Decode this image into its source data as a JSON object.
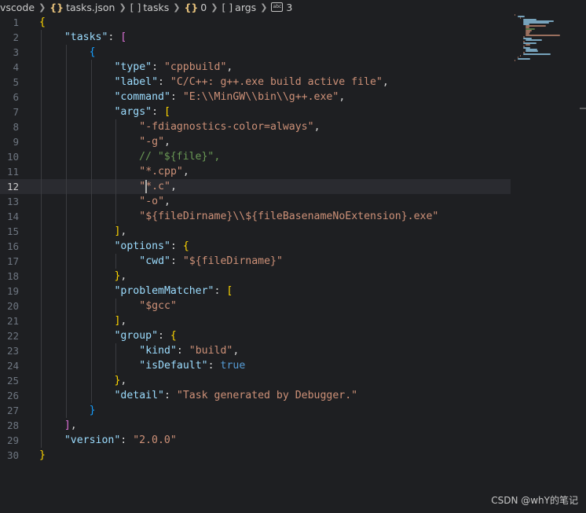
{
  "breadcrumb": {
    "items": [
      {
        "label": "vscode",
        "icon": ""
      },
      {
        "label": "tasks.json",
        "icon": "{}"
      },
      {
        "label": "tasks",
        "icon": "[ ]"
      },
      {
        "label": "0",
        "icon": "{}"
      },
      {
        "label": "args",
        "icon": "[ ]"
      },
      {
        "label": "3",
        "icon": "abc"
      }
    ]
  },
  "editor": {
    "active_line": 12,
    "lines": [
      "{",
      "    \"tasks\": [",
      "        {",
      "            \"type\": \"cppbuild\",",
      "            \"label\": \"C/C++: g++.exe build active file\",",
      "            \"command\": \"E:\\\\MinGW\\\\bin\\\\g++.exe\",",
      "            \"args\": [",
      "                \"-fdiagnostics-color=always\",",
      "                \"-g\",",
      "                // \"${file}\",",
      "                \"*.cpp\",",
      "                \"*.c\",",
      "                \"-o\",",
      "                \"${fileDirname}\\\\${fileBasenameNoExtension}.exe\"",
      "            ],",
      "            \"options\": {",
      "                \"cwd\": \"${fileDirname}\"",
      "            },",
      "            \"problemMatcher\": [",
      "                \"$gcc\"",
      "            ],",
      "            \"group\": {",
      "                \"kind\": \"build\",",
      "                \"isDefault\": true",
      "            },",
      "            \"detail\": \"Task generated by Debugger.\"",
      "        }",
      "    ],",
      "    \"version\": \"2.0.0\"",
      "}"
    ]
  },
  "colors": {
    "background": "#1e1f22",
    "key": "#9cdcfe",
    "string": "#ce9178",
    "boolean": "#569cd6",
    "comment": "#6a9955",
    "bracket_level1": "#ffd700",
    "bracket_level2": "#da70d6",
    "bracket_level3": "#179fff"
  },
  "watermark": "CSDN @whY的笔记"
}
